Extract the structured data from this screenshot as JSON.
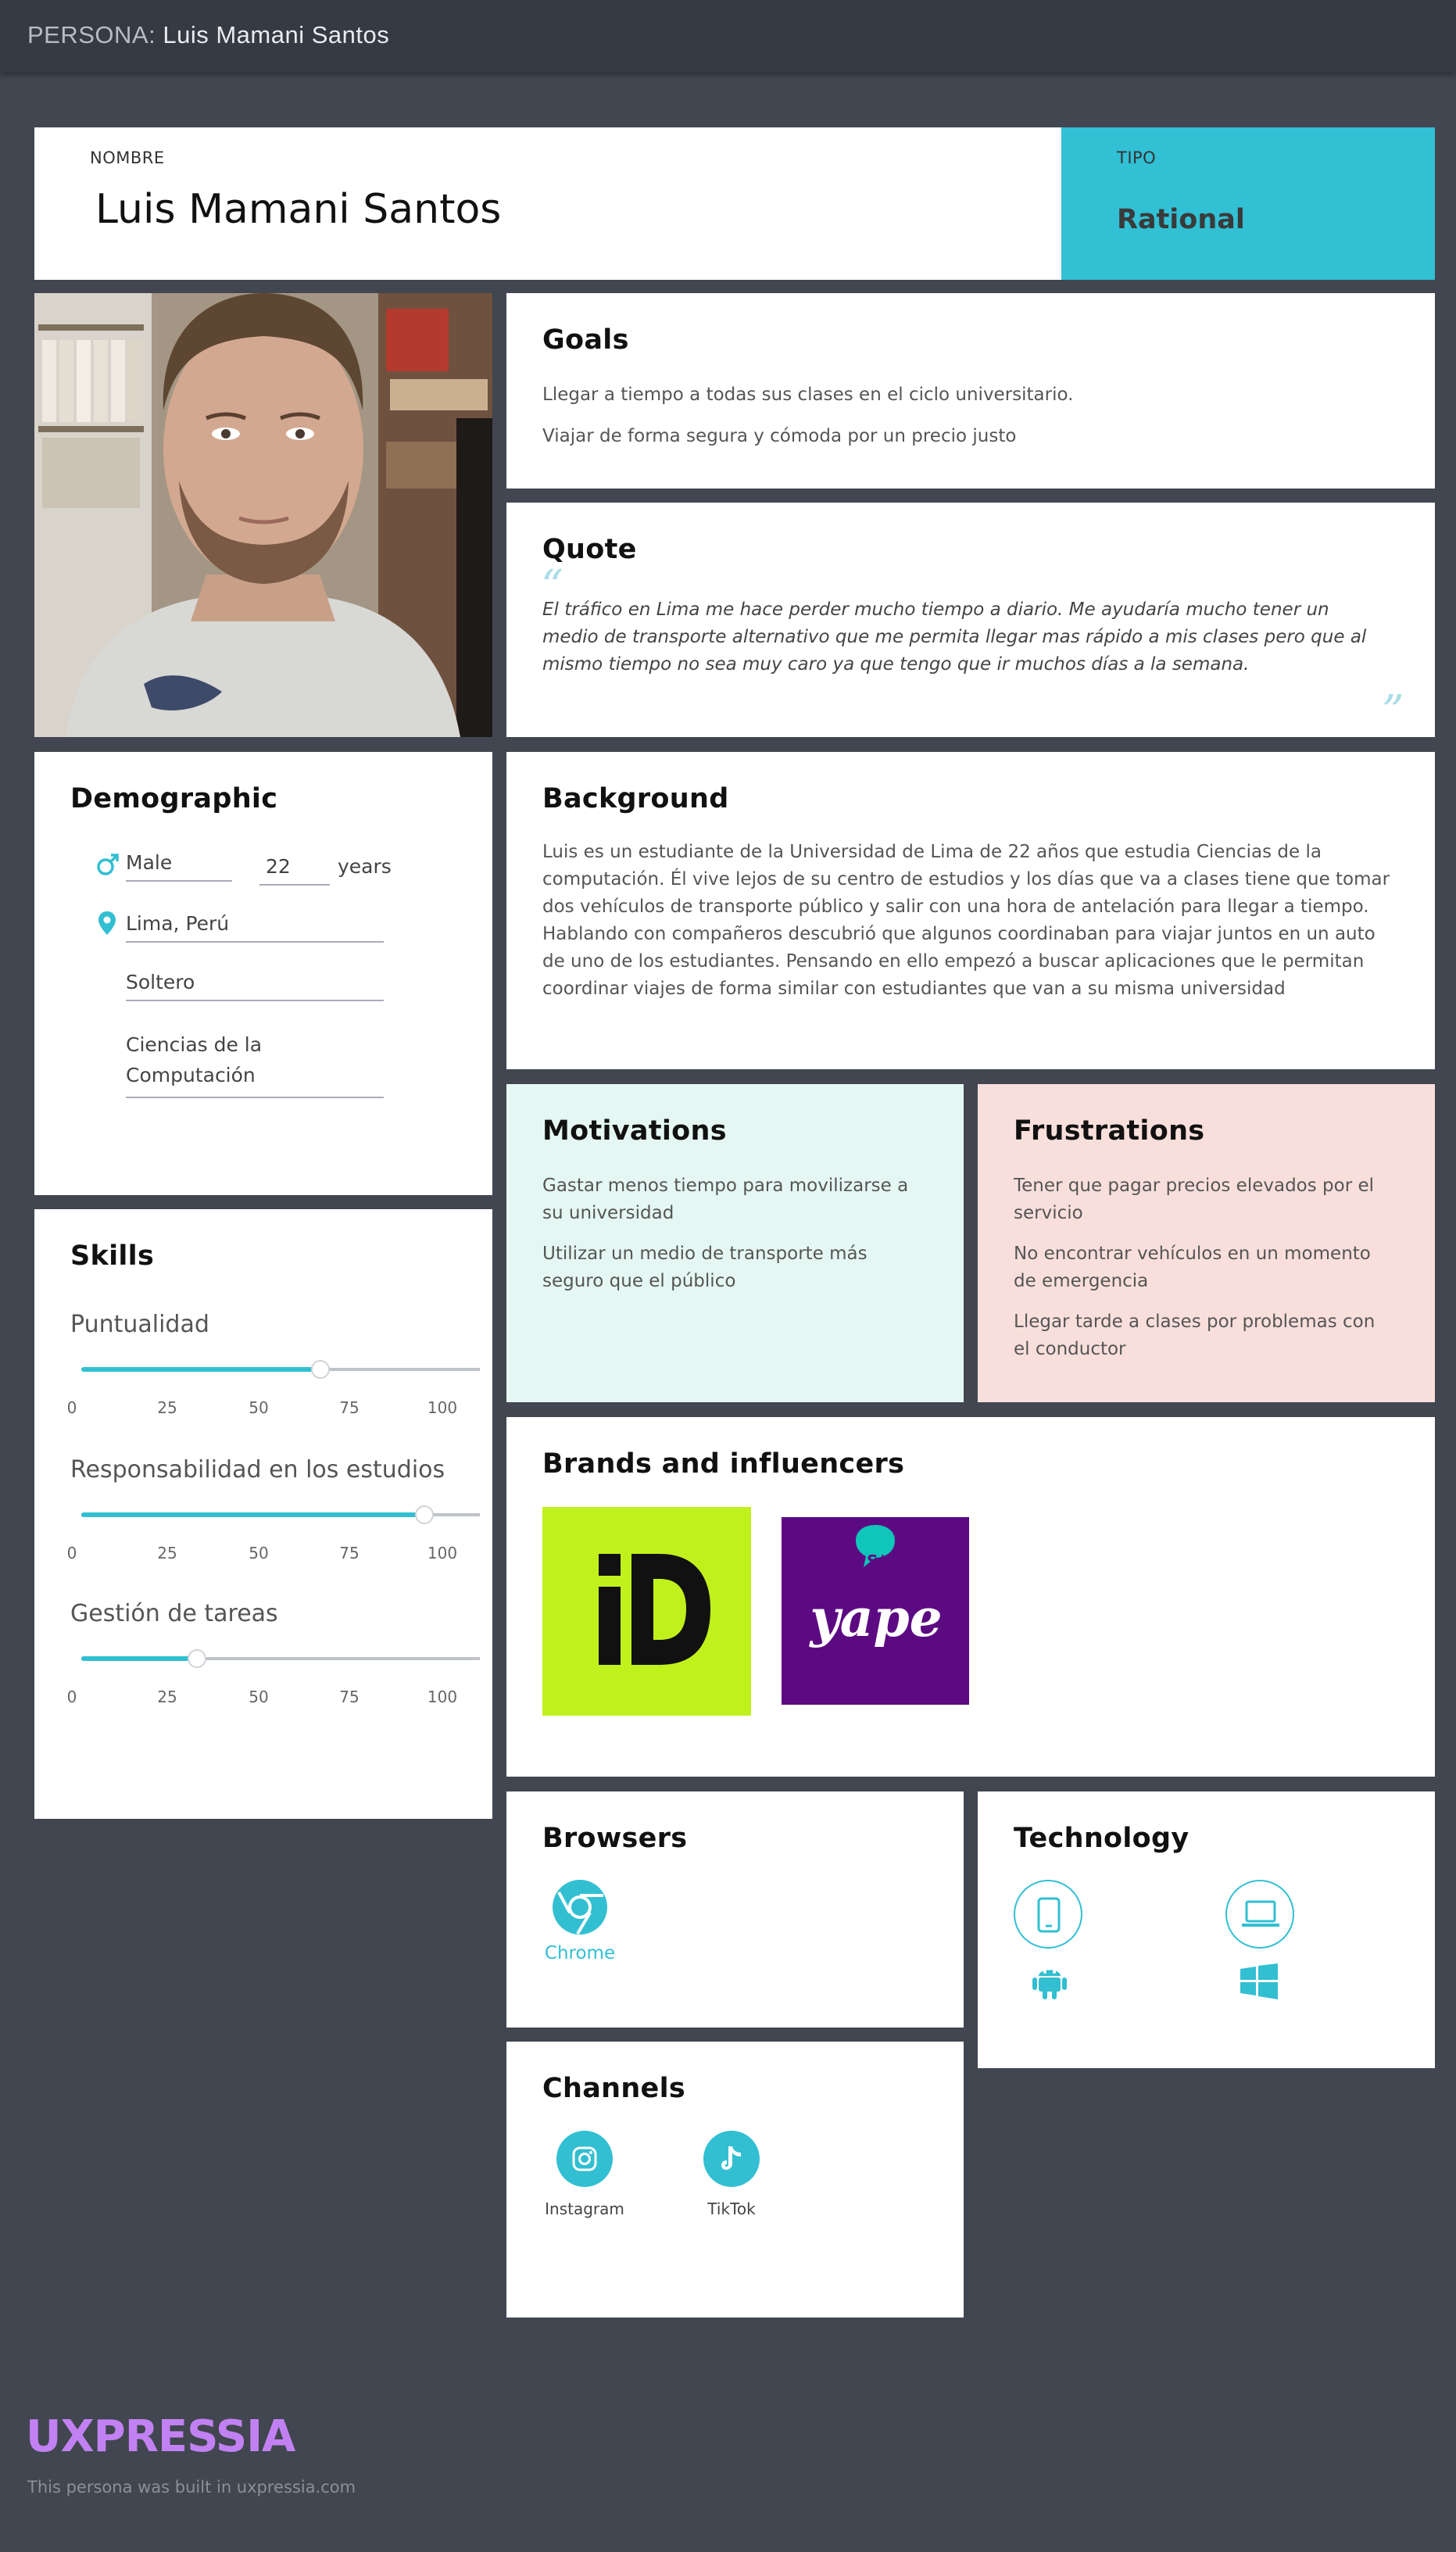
{
  "header": {
    "prefix": "PERSONA:",
    "name": "Luis Mamani Santos"
  },
  "identity": {
    "name_label": "NOMBRE",
    "name": "Luis Mamani Santos",
    "type_label": "TIPO",
    "type": "Rational"
  },
  "goals": {
    "title": "Goals",
    "items": [
      "Llegar a tiempo a todas sus clases en el ciclo universitario.",
      "Viajar de forma segura y cómoda por un precio justo"
    ]
  },
  "quote": {
    "title": "Quote",
    "open_mark": "“",
    "close_mark": "”",
    "lines": [
      "El tráfico en Lima me hace perder mucho tiempo a diario. Me ayudaría mucho tener un",
      "medio de transporte alternativo que me permita llegar mas rápido a mis clases pero que al",
      "mismo tiempo no sea muy caro ya que tengo que ir muchos días a la semana."
    ]
  },
  "demographic": {
    "title": "Demographic",
    "gender": "Male",
    "age": "22",
    "age_unit": "years",
    "location": "Lima, Perú",
    "status": "Soltero",
    "career_line1": "Ciencias de la",
    "career_line2": "Computación"
  },
  "background": {
    "title": "Background",
    "lines": [
      "Luis es un estudiante de la Universidad de Lima de 22 años que estudia Ciencias de la",
      "computación. Él vive lejos de su centro de estudios y los días que va a clases tiene que tomar",
      "dos vehículos de transporte público y salir con una hora de antelación para llegar a tiempo.",
      "Hablando con compañeros descubrió que algunos coordinaban para viajar juntos en un auto",
      "de uno de los estudiantes. Pensando en ello empezó a buscar aplicaciones que le permitan",
      "coordinar viajes de forma similar con estudiantes que van a su misma universidad"
    ]
  },
  "skills": {
    "title": "Skills",
    "ticks": [
      "0",
      "25",
      "50",
      "75",
      "100"
    ],
    "items": [
      {
        "name": "Puntualidad",
        "value": 60
      },
      {
        "name": "Responsabilidad en los estudios",
        "value": 86
      },
      {
        "name": "Gestión de tareas",
        "value": 29
      }
    ]
  },
  "motivations": {
    "title": "Motivations",
    "items": [
      [
        "Gastar menos tiempo para movilizarse a",
        "su universidad"
      ],
      [
        "Utilizar un medio de transporte más",
        "seguro que el público"
      ]
    ]
  },
  "frustrations": {
    "title": "Frustrations",
    "items": [
      [
        "Tener que pagar precios elevados por el",
        "servicio"
      ],
      [
        "No encontrar vehículos en un momento",
        "de emergencia"
      ],
      [
        "Llegar tarde a clases por problemas con",
        "el conductor"
      ]
    ]
  },
  "brands": {
    "title": "Brands and influencers",
    "items": [
      {
        "name": "iD",
        "color": "#c1f11c"
      },
      {
        "name": "yape",
        "badge": "S/",
        "color": "#5c0a82"
      }
    ]
  },
  "browsers": {
    "title": "Browsers",
    "items": [
      {
        "name": "Chrome",
        "icon": "chrome-icon"
      }
    ]
  },
  "technology": {
    "title": "Technology",
    "icons": [
      "smartphone-icon",
      "laptop-icon",
      "android-icon",
      "windows-icon"
    ]
  },
  "channels": {
    "title": "Channels",
    "items": [
      {
        "name": "Instagram",
        "icon": "instagram-icon"
      },
      {
        "name": "TikTok",
        "icon": "tiktok-icon"
      }
    ]
  },
  "footer": {
    "logo": "UXPRESSIA",
    "note": "This persona was built in uxpressia.com"
  },
  "colors": {
    "accent": "#32bfd2",
    "background": "#414650",
    "motivations_bg": "#e5f7f3",
    "frustrations_bg": "#f9dfdb",
    "logo": "#c281f2"
  }
}
